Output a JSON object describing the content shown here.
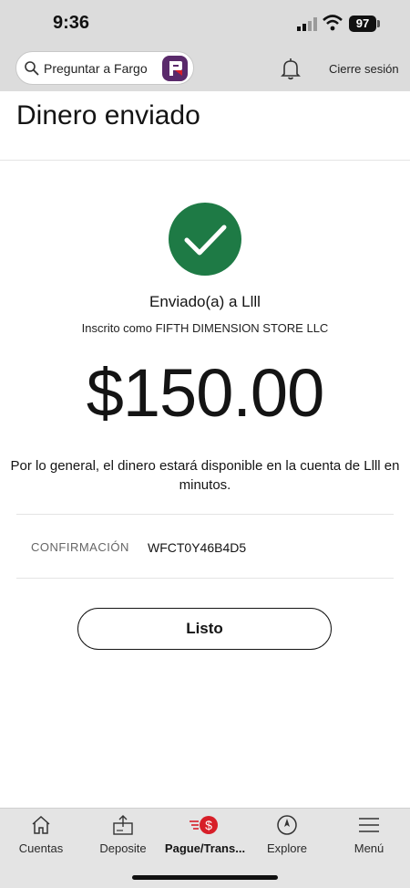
{
  "status_bar": {
    "time": "9:36",
    "battery": "97"
  },
  "header": {
    "search_placeholder": "Preguntar a Fargo",
    "logout_label": "Cierre sesión"
  },
  "page": {
    "title": "Dinero enviado",
    "sent_to": "Enviado(a) a Llll",
    "enrolled_as": "Inscrito como FIFTH DIMENSION STORE LLC",
    "amount": "$150.00",
    "availability_note": "Por lo general, el dinero estará disponible en la cuenta de Llll en minutos.",
    "confirmation_label": "CONFIRMACIÓN",
    "confirmation_value": "WFCT0Y46B4D5",
    "done_label": "Listo"
  },
  "tabs": [
    {
      "label": "Cuentas",
      "icon": "home-icon"
    },
    {
      "label": "Deposite",
      "icon": "deposit-icon"
    },
    {
      "label": "Pague/Trans...",
      "icon": "pay-transfer-icon",
      "active": true
    },
    {
      "label": "Explore",
      "icon": "compass-icon"
    },
    {
      "label": "Menú",
      "icon": "menu-icon"
    }
  ],
  "colors": {
    "success": "#1e7a45",
    "brand_red": "#d71e28",
    "fargo_purple": "#5a2a6b",
    "header_bg": "#dcdcdc"
  }
}
